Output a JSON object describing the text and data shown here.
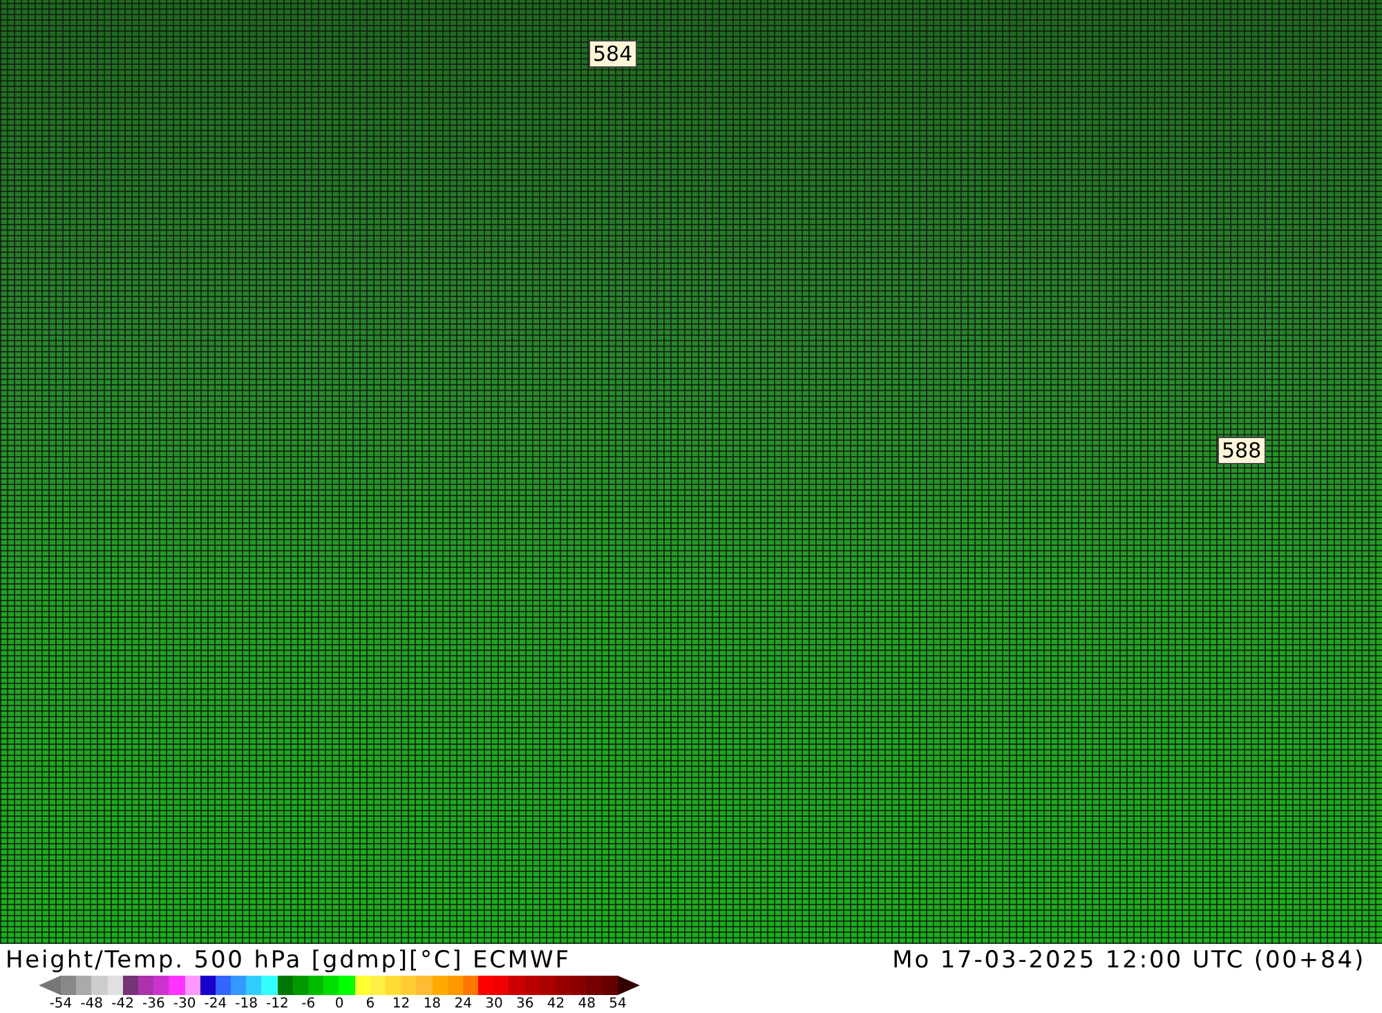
{
  "map": {
    "contour_labels": [
      {
        "text": "584"
      },
      {
        "text": "588"
      }
    ]
  },
  "footer": {
    "title": "Height/Temp. 500 hPa [gdmp][°C] ECMWF",
    "valid_time": "Mo 17-03-2025 12:00 UTC (00+84)"
  },
  "legend": {
    "swatches": [
      {
        "kind": "arrow-left",
        "color": "#777777"
      },
      {
        "kind": "block",
        "color": "#888888"
      },
      {
        "kind": "block",
        "color": "#aaaaaa"
      },
      {
        "kind": "block",
        "color": "#cccccc"
      },
      {
        "kind": "block",
        "color": "#e0e0e0"
      },
      {
        "kind": "block",
        "color": "#773377"
      },
      {
        "kind": "block",
        "color": "#aa33aa"
      },
      {
        "kind": "block",
        "color": "#cc33cc"
      },
      {
        "kind": "block",
        "color": "#ff33ff"
      },
      {
        "kind": "block",
        "color": "#ff99ff"
      },
      {
        "kind": "block",
        "color": "#1a00cc"
      },
      {
        "kind": "block",
        "color": "#3366ff"
      },
      {
        "kind": "block",
        "color": "#3399ff"
      },
      {
        "kind": "block",
        "color": "#33ccff"
      },
      {
        "kind": "block",
        "color": "#33ffff"
      },
      {
        "kind": "block",
        "color": "#007700"
      },
      {
        "kind": "block",
        "color": "#009900"
      },
      {
        "kind": "block",
        "color": "#00bb00"
      },
      {
        "kind": "block",
        "color": "#00dd00"
      },
      {
        "kind": "block",
        "color": "#00ff00"
      },
      {
        "kind": "block",
        "color": "#ffff33"
      },
      {
        "kind": "block",
        "color": "#ffee44"
      },
      {
        "kind": "block",
        "color": "#ffdd33"
      },
      {
        "kind": "block",
        "color": "#ffcc33"
      },
      {
        "kind": "block",
        "color": "#ffbb33"
      },
      {
        "kind": "block",
        "color": "#ffaa00"
      },
      {
        "kind": "block",
        "color": "#ff9900"
      },
      {
        "kind": "block",
        "color": "#ff7700"
      },
      {
        "kind": "block",
        "color": "#ff0000"
      },
      {
        "kind": "block",
        "color": "#ee0000"
      },
      {
        "kind": "block",
        "color": "#cc0000"
      },
      {
        "kind": "block",
        "color": "#bb0000"
      },
      {
        "kind": "block",
        "color": "#aa0000"
      },
      {
        "kind": "block",
        "color": "#990000"
      },
      {
        "kind": "block",
        "color": "#880000"
      },
      {
        "kind": "block",
        "color": "#770000"
      },
      {
        "kind": "block",
        "color": "#660000"
      },
      {
        "kind": "arrow-right",
        "color": "#330000"
      }
    ],
    "ticks": [
      "-54",
      "-48",
      "-42",
      "-36",
      "-30",
      "-24",
      "-18",
      "-12",
      "-6",
      "0",
      "6",
      "12",
      "18",
      "24",
      "30",
      "36",
      "42",
      "48",
      "54"
    ]
  }
}
